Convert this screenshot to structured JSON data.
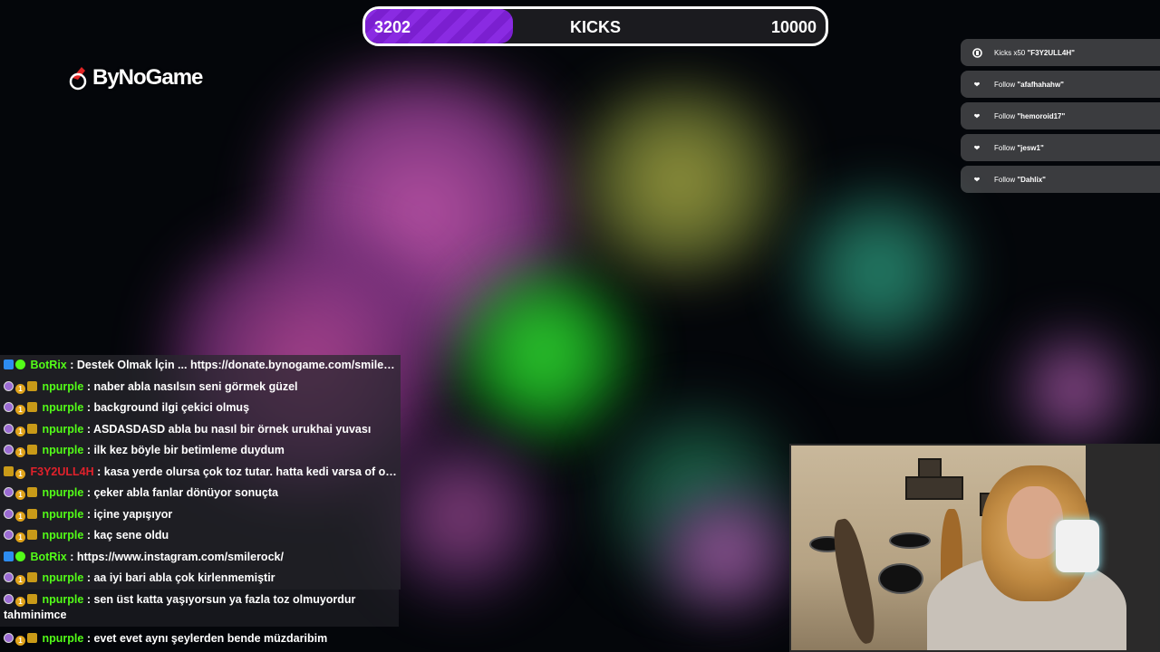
{
  "kicks_bar": {
    "current": "3202",
    "label": "KICKS",
    "goal": "10000",
    "progress": 0.3202,
    "fill_color": "#8a2be2"
  },
  "brand": {
    "name": "ByNoGame",
    "icon": "bynogame-logo-icon"
  },
  "alerts": [
    {
      "icon": "kick-icon",
      "text": "Kicks x50",
      "user": "\"F3Y2ULL4H\""
    },
    {
      "icon": "heart-icon",
      "text": "Follow",
      "user": "\"afafhahahw\""
    },
    {
      "icon": "heart-icon",
      "text": "Follow",
      "user": "\"hemoroid17\""
    },
    {
      "icon": "heart-icon",
      "text": "Follow",
      "user": "\"jesw1\""
    },
    {
      "icon": "heart-icon",
      "text": "Follow",
      "user": "\"Dahlix\""
    }
  ],
  "chat": {
    "messages": [
      {
        "badges": [
          "bot",
          "verified"
        ],
        "user": "BotRix",
        "color": "green",
        "text": ": Destek Olmak İçin ... https://donate.bynogame.com/smilerock"
      },
      {
        "badges": [
          "sub",
          "one",
          "crown"
        ],
        "user": "npurple",
        "color": "green",
        "text": ": naber abla nasılsın seni görmek güzel"
      },
      {
        "badges": [
          "sub",
          "one",
          "crown"
        ],
        "user": "npurple",
        "color": "green",
        "text": ": background ilgi çekici olmuş"
      },
      {
        "badges": [
          "sub",
          "one",
          "crown"
        ],
        "user": "npurple",
        "color": "green",
        "text": ": ASDASDASD abla bu nasıl bir örnek urukhai yuvası"
      },
      {
        "badges": [
          "sub",
          "one",
          "crown"
        ],
        "user": "npurple",
        "color": "green",
        "text": ": ilk kez böyle bir betimleme duydum"
      },
      {
        "badges": [
          "gift",
          "one"
        ],
        "user": "F3Y2ULL4H",
        "color": "red",
        "text": ": kasa yerde olursa çok toz tutar. hatta kedi varsa of of..."
      },
      {
        "badges": [
          "sub",
          "one",
          "crown"
        ],
        "user": "npurple",
        "color": "green",
        "text": ": çeker abla fanlar dönüyor sonuçta"
      },
      {
        "badges": [
          "sub",
          "one",
          "crown"
        ],
        "user": "npurple",
        "color": "green",
        "text": ": içine yapışıyor"
      },
      {
        "badges": [
          "sub",
          "one",
          "crown"
        ],
        "user": "npurple",
        "color": "green",
        "text": ": kaç sene oldu"
      },
      {
        "badges": [
          "bot",
          "verified"
        ],
        "user": "BotRix",
        "color": "green",
        "text": ": https://www.instagram.com/smilerock/"
      },
      {
        "badges": [
          "sub",
          "one",
          "crown"
        ],
        "user": "npurple",
        "color": "green",
        "text": ": aa iyi bari abla çok kirlenmemiştir"
      },
      {
        "badges": [
          "sub",
          "one",
          "crown"
        ],
        "user": "npurple",
        "color": "green",
        "text": ": sen üst katta yaşıyorsun ya fazla toz olmuyordur tahminimce"
      }
    ],
    "last": {
      "badges": [
        "sub",
        "one",
        "crown"
      ],
      "user": "npurple",
      "text": ": evet evet aynı şeylerden bende müzdaribim"
    }
  },
  "webcam": {
    "description_icon": "webcam-feed"
  }
}
